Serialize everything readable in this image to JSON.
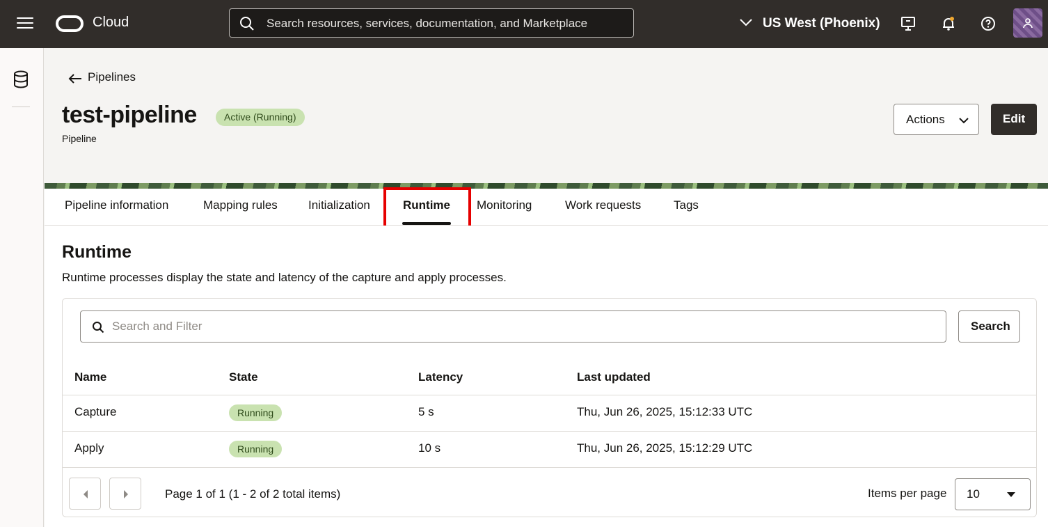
{
  "topbar": {
    "brand": "Cloud",
    "search_placeholder": "Search resources, services, documentation, and Marketplace",
    "region": "US West (Phoenix)"
  },
  "header": {
    "back_label": "Pipelines",
    "title": "test-pipeline",
    "status_badge": "Active (Running)",
    "subtitle": "Pipeline",
    "actions_label": "Actions",
    "edit_label": "Edit"
  },
  "tabs": [
    {
      "label": "Pipeline information"
    },
    {
      "label": "Mapping rules"
    },
    {
      "label": "Initialization"
    },
    {
      "label": "Runtime",
      "active": true
    },
    {
      "label": "Monitoring"
    },
    {
      "label": "Work requests"
    },
    {
      "label": "Tags"
    }
  ],
  "runtime": {
    "title": "Runtime",
    "description": "Runtime processes display the state and latency of the capture and apply processes.",
    "filter_placeholder": "Search and Filter",
    "search_button": "Search",
    "columns": [
      "Name",
      "State",
      "Latency",
      "Last updated"
    ],
    "rows": [
      {
        "name": "Capture",
        "state": "Running",
        "latency": "5 s",
        "last_updated": "Thu, Jun 26, 2025, 15:12:33 UTC"
      },
      {
        "name": "Apply",
        "state": "Running",
        "latency": "10 s",
        "last_updated": "Thu, Jun 26, 2025, 15:12:29 UTC"
      }
    ],
    "pagination": {
      "info": "Page 1 of 1 (1 - 2 of 2 total items)",
      "items_per_page_label": "Items per page",
      "items_per_page_value": "10"
    }
  },
  "colors": {
    "topbar_bg": "#312d2a",
    "status_green": "#c9e2b0",
    "highlight_red": "#e60000"
  },
  "icons": [
    "menu-icon",
    "oracle-logo-icon",
    "search-icon",
    "chevron-down-icon",
    "monitor-icon",
    "bell-icon",
    "help-icon",
    "avatar-icon",
    "database-icon",
    "arrow-left-icon",
    "chevron-left-icon",
    "chevron-right-icon",
    "caret-down-icon"
  ]
}
